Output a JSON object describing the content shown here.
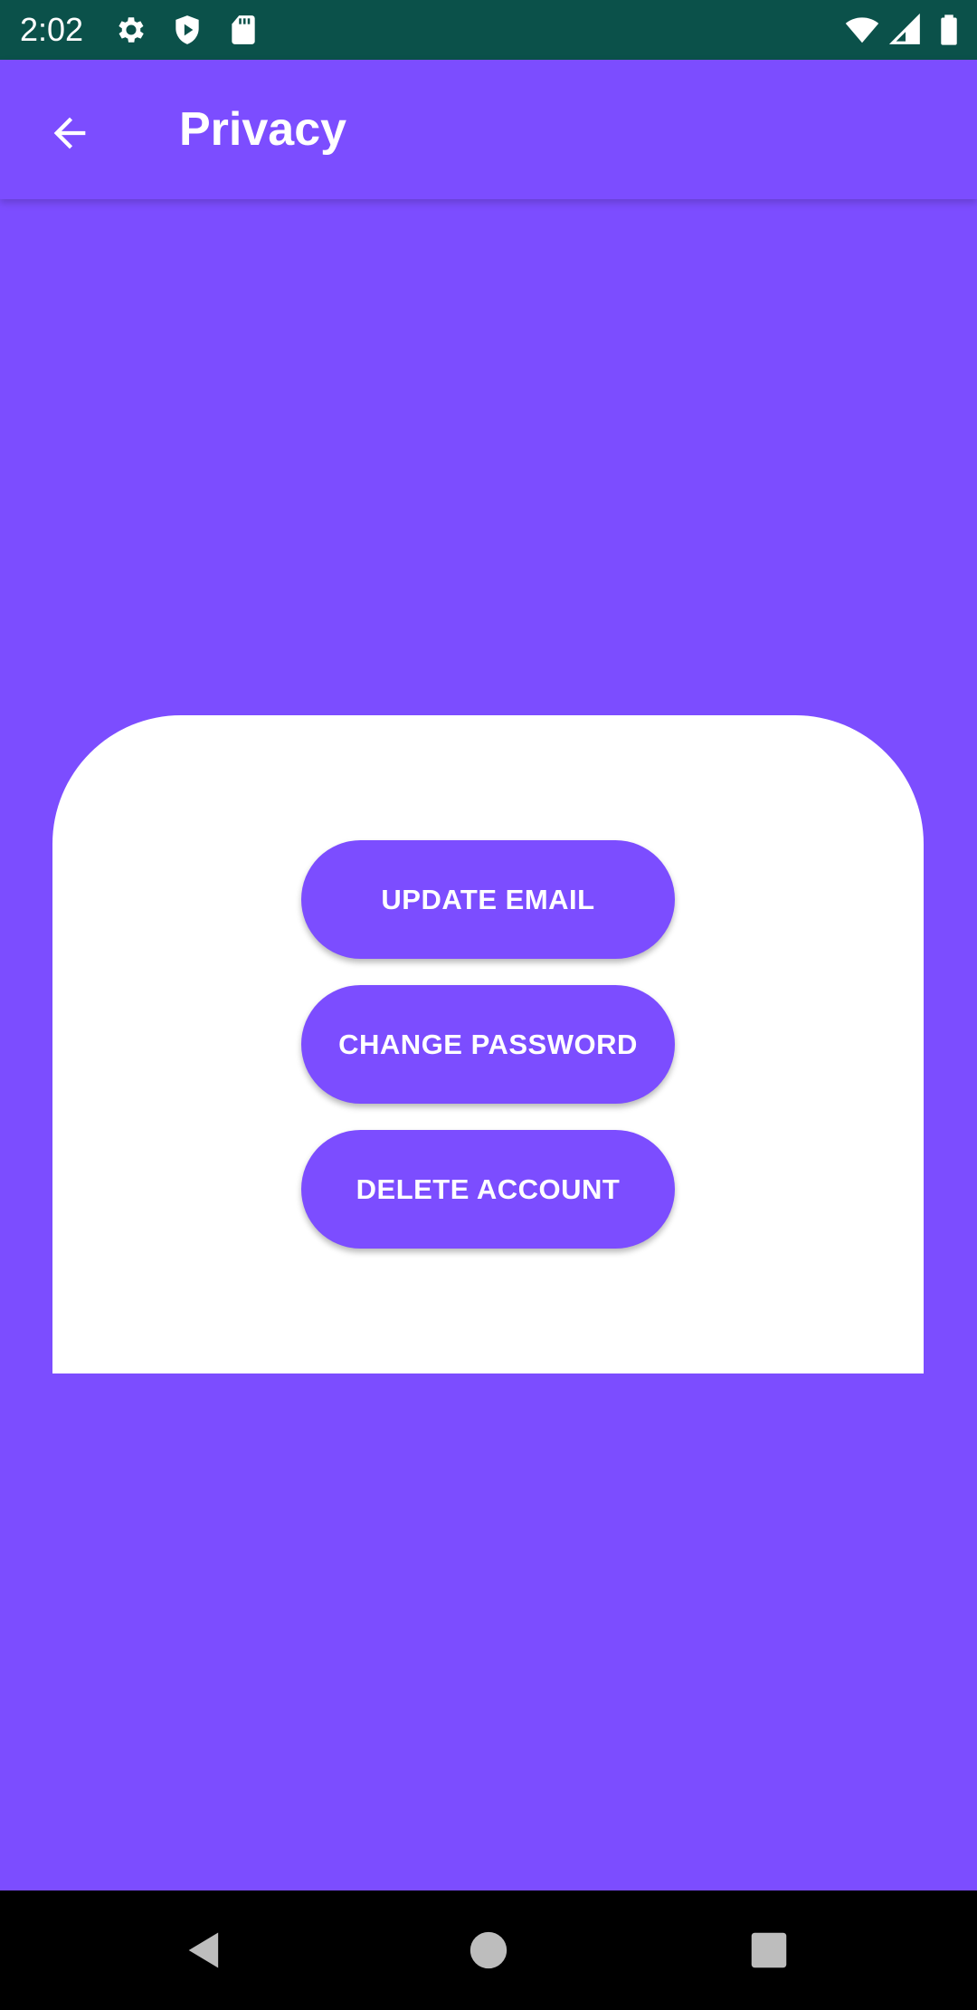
{
  "status_bar": {
    "time": "2:02",
    "left_icons": [
      "gear-icon",
      "shield-play-icon",
      "sd-card-icon"
    ],
    "right_icons": [
      "wifi-icon",
      "signal-icon",
      "battery-icon"
    ]
  },
  "app_bar": {
    "title": "Privacy",
    "back_icon": "arrow-left-icon"
  },
  "card": {
    "buttons": [
      {
        "label": "UPDATE EMAIL"
      },
      {
        "label": "CHANGE PASSWORD"
      },
      {
        "label": "DELETE ACCOUNT"
      }
    ]
  },
  "nav_bar": {
    "icons": [
      "back-triangle-icon",
      "home-circle-icon",
      "recents-square-icon"
    ]
  },
  "colors": {
    "primary": "#7c4dff",
    "status_bar": "#0b514a",
    "card": "#ffffff",
    "nav_bar": "#000000"
  }
}
